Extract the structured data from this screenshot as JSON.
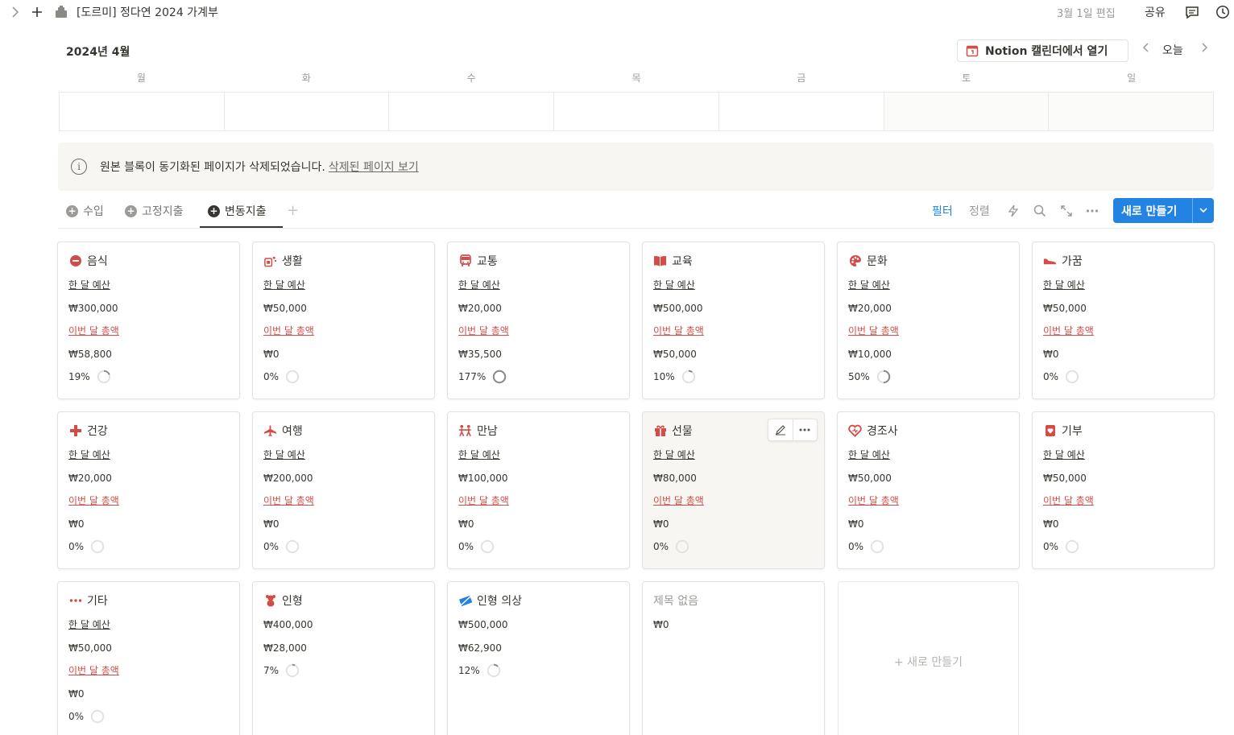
{
  "topbar": {
    "breadcrumb_title": "[도르미] 정다연 2024 가계부",
    "edited": "3월 1일 편집",
    "share": "공유"
  },
  "calendar": {
    "month_title": "2024년 4월",
    "open_button": "Notion 캘린더에서 열기",
    "today": "오늘",
    "weekdays": [
      "월",
      "화",
      "수",
      "목",
      "금",
      "토",
      "일"
    ]
  },
  "callout": {
    "text": "원본 블록이 동기화된 페이지가 삭제되었습니다.",
    "link": "삭제된 페이지 보기"
  },
  "tabs": [
    {
      "label": "수입"
    },
    {
      "label": "고정지출"
    },
    {
      "label": "변동지출"
    }
  ],
  "toolbar": {
    "filter": "필터",
    "sort": "정렬",
    "new_button": "새로 만들기"
  },
  "labels": {
    "budget": "한 달 예산",
    "total": "이번 달 총액"
  },
  "colors": {
    "accent": "#2383e2",
    "icon_red": "#d44c47",
    "ring_track": "#e3e2e0",
    "ring_fill": "#8a8985"
  },
  "cards": [
    {
      "title": "음식",
      "icon": "no-entry-icon",
      "budget": "₩300,000",
      "spent": "₩58,800",
      "percent": "19%",
      "progress": 0.19
    },
    {
      "title": "생활",
      "icon": "household-icon",
      "budget": "₩50,000",
      "spent": "₩0",
      "percent": "0%",
      "progress": 0
    },
    {
      "title": "교통",
      "icon": "bus-icon",
      "budget": "₩20,000",
      "spent": "₩35,500",
      "percent": "177%",
      "progress": 1.0
    },
    {
      "title": "교육",
      "icon": "book-icon",
      "budget": "₩500,000",
      "spent": "₩50,000",
      "percent": "10%",
      "progress": 0.1
    },
    {
      "title": "문화",
      "icon": "palette-icon",
      "budget": "₩20,000",
      "spent": "₩10,000",
      "percent": "50%",
      "progress": 0.5
    },
    {
      "title": "가꿈",
      "icon": "shoe-icon",
      "budget": "₩50,000",
      "spent": "₩0",
      "percent": "0%",
      "progress": 0
    },
    {
      "title": "건강",
      "icon": "medical-cross-icon",
      "budget": "₩20,000",
      "spent": "₩0",
      "percent": "0%",
      "progress": 0
    },
    {
      "title": "여행",
      "icon": "airplane-icon",
      "budget": "₩200,000",
      "spent": "₩0",
      "percent": "0%",
      "progress": 0
    },
    {
      "title": "만남",
      "icon": "people-icon",
      "budget": "₩100,000",
      "spent": "₩0",
      "percent": "0%",
      "progress": 0
    },
    {
      "title": "선물",
      "icon": "gift-icon",
      "budget": "₩80,000",
      "spent": "₩0",
      "percent": "0%",
      "progress": 0
    },
    {
      "title": "경조사",
      "icon": "heart-icon",
      "budget": "₩50,000",
      "spent": "₩0",
      "percent": "0%",
      "progress": 0
    },
    {
      "title": "기부",
      "icon": "donation-icon",
      "budget": "₩50,000",
      "spent": "₩0",
      "percent": "0%",
      "progress": 0
    },
    {
      "title": "기타",
      "icon": "ellipsis-icon",
      "budget": "₩50,000",
      "spent": "₩0",
      "percent": "0%",
      "progress": 0
    }
  ],
  "extra_cards": [
    {
      "title": "인형",
      "icon": "teddy-bear-icon",
      "amount1": "₩400,000",
      "amount2": "₩28,000",
      "percent": "7%",
      "progress": 0.07
    },
    {
      "title": "인형 의상",
      "icon": "sewing-icon",
      "amount1": "₩500,000",
      "amount2": "₩62,900",
      "percent": "12%",
      "progress": 0.12
    }
  ],
  "untitled_card": {
    "title": "제목 없음",
    "amount": "₩0"
  },
  "add_card": {
    "label": "+ 새로 만들기"
  }
}
